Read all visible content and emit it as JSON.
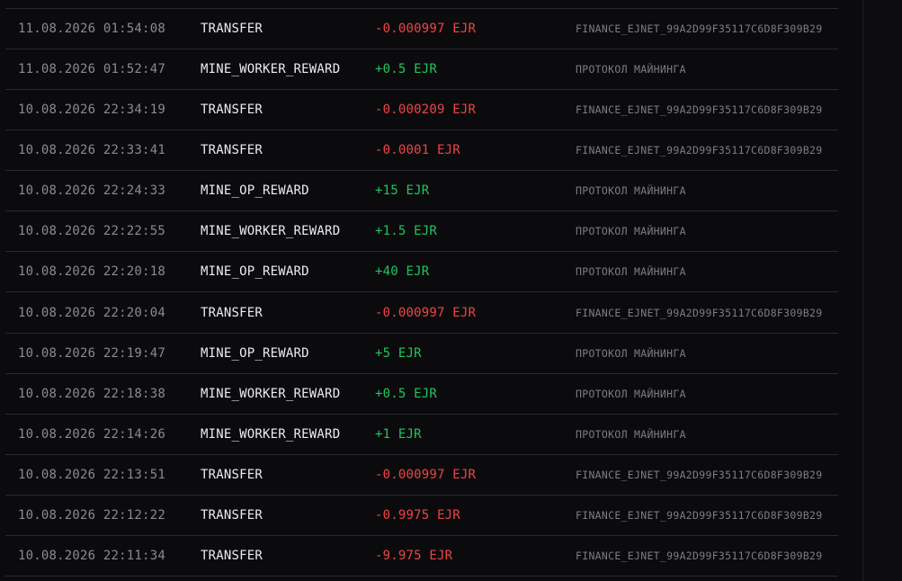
{
  "transactions": [
    {
      "datetime": "11.08.2026 01:54:08",
      "type": "TRANSFER",
      "amount": "-0.000997 EJR",
      "sign": "neg",
      "source": "FINANCE_EJNET_99A2D99F35117C6D8F309B29"
    },
    {
      "datetime": "11.08.2026 01:52:47",
      "type": "MINE_WORKER_REWARD",
      "amount": "+0.5 EJR",
      "sign": "pos",
      "source": "ПРОТОКОЛ МАЙНИНГА"
    },
    {
      "datetime": "10.08.2026 22:34:19",
      "type": "TRANSFER",
      "amount": "-0.000209 EJR",
      "sign": "neg",
      "source": "FINANCE_EJNET_99A2D99F35117C6D8F309B29"
    },
    {
      "datetime": "10.08.2026 22:33:41",
      "type": "TRANSFER",
      "amount": "-0.0001 EJR",
      "sign": "neg",
      "source": "FINANCE_EJNET_99A2D99F35117C6D8F309B29"
    },
    {
      "datetime": "10.08.2026 22:24:33",
      "type": "MINE_OP_REWARD",
      "amount": "+15 EJR",
      "sign": "pos",
      "source": "ПРОТОКОЛ МАЙНИНГА"
    },
    {
      "datetime": "10.08.2026 22:22:55",
      "type": "MINE_WORKER_REWARD",
      "amount": "+1.5 EJR",
      "sign": "pos",
      "source": "ПРОТОКОЛ МАЙНИНГА"
    },
    {
      "datetime": "10.08.2026 22:20:18",
      "type": "MINE_OP_REWARD",
      "amount": "+40 EJR",
      "sign": "pos",
      "source": "ПРОТОКОЛ МАЙНИНГА"
    },
    {
      "datetime": "10.08.2026 22:20:04",
      "type": "TRANSFER",
      "amount": "-0.000997 EJR",
      "sign": "neg",
      "source": "FINANCE_EJNET_99A2D99F35117C6D8F309B29"
    },
    {
      "datetime": "10.08.2026 22:19:47",
      "type": "MINE_OP_REWARD",
      "amount": "+5 EJR",
      "sign": "pos",
      "source": "ПРОТОКОЛ МАЙНИНГА"
    },
    {
      "datetime": "10.08.2026 22:18:38",
      "type": "MINE_WORKER_REWARD",
      "amount": "+0.5 EJR",
      "sign": "pos",
      "source": "ПРОТОКОЛ МАЙНИНГА"
    },
    {
      "datetime": "10.08.2026 22:14:26",
      "type": "MINE_WORKER_REWARD",
      "amount": "+1 EJR",
      "sign": "pos",
      "source": "ПРОТОКОЛ МАЙНИНГА"
    },
    {
      "datetime": "10.08.2026 22:13:51",
      "type": "TRANSFER",
      "amount": "-0.000997 EJR",
      "sign": "neg",
      "source": "FINANCE_EJNET_99A2D99F35117C6D8F309B29"
    },
    {
      "datetime": "10.08.2026 22:12:22",
      "type": "TRANSFER",
      "amount": "-0.9975 EJR",
      "sign": "neg",
      "source": "FINANCE_EJNET_99A2D99F35117C6D8F309B29"
    },
    {
      "datetime": "10.08.2026 22:11:34",
      "type": "TRANSFER",
      "amount": "-9.975 EJR",
      "sign": "neg",
      "source": "FINANCE_EJNET_99A2D99F35117C6D8F309B29"
    }
  ],
  "colors": {
    "negative": "#ef4444",
    "positive": "#22c55e",
    "background": "#0b0b0d"
  }
}
